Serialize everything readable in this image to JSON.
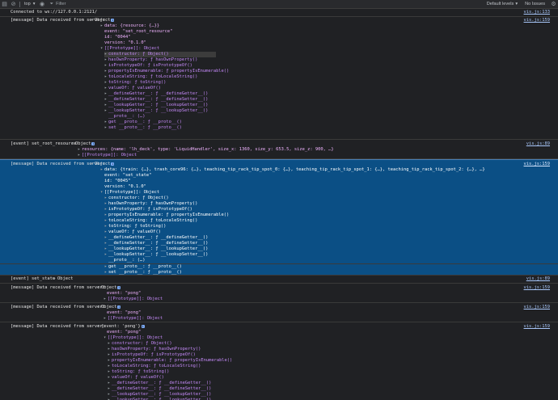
{
  "toolbar": {
    "context": "top",
    "filter_placeholder": "Filter",
    "levels": "Default levels",
    "issues": "No Issues"
  },
  "lines": {
    "connected": "Connected to ws://127.0.0.1:2121/",
    "recv": "[message] Data received from server:",
    "object": "Object",
    "data_resource": "data: {resource: {…}}",
    "event_set_root": "event: \"set_root_resource\"",
    "id_0044": "id: \"0044\"",
    "version": "version: \"0.1.0\"",
    "prototype_object": "[[Prototype]]: Object",
    "constructor": "constructor: ƒ Object()",
    "hasOwnProperty": "hasOwnProperty: ƒ hasOwnProperty()",
    "isPrototypeOf": "isPrototypeOf: ƒ isPrototypeOf()",
    "propertyIsEnumerable": "propertyIsEnumerable: ƒ propertyIsEnumerable()",
    "toLocaleString": "toLocaleString: ƒ toLocaleString()",
    "toString": "toString: ƒ toString()",
    "valueOf": "valueOf: ƒ valueOf()",
    "defineGetter": "__defineGetter__: ƒ __defineGetter__()",
    "defineSetter": "__defineSetter__: ƒ __defineSetter__()",
    "lookupGetter": "__lookupGetter__: ƒ __lookupGetter__()",
    "lookupSetter": "__lookupSetter__: ƒ __lookupSetter__()",
    "proto": "__proto__: (…)",
    "get_proto": "get __proto__: ƒ __proto__()",
    "set_proto": "set __proto__: ƒ __proto__()",
    "event_set_root_resource": "[event] set_root_resource",
    "resources_line": "resources: {name: 'lh_deck', type: 'LiquidHandler', size_x: 1360, size_y: 653.5, size_z: 900, …}",
    "data_train": "data: {train: {…}, trash_core96: {…}, teaching_tip_rack_tip_spot_0: {…}, teaching_tip_rack_tip_spot_1: {…}, teaching_tip_rack_tip_spot_2: {…}, …}",
    "event_set_state": "event: \"set_state\"",
    "id_0045": "id: \"0045\"",
    "event_set_state_log": "[event] set_state",
    "event_pong": "event: \"pong\"",
    "pong_obj": "{event: 'pong'}"
  },
  "sources": {
    "vis159": "vis.js:159",
    "vis133": "vis.js:133",
    "vis89": "vis.js:89"
  }
}
